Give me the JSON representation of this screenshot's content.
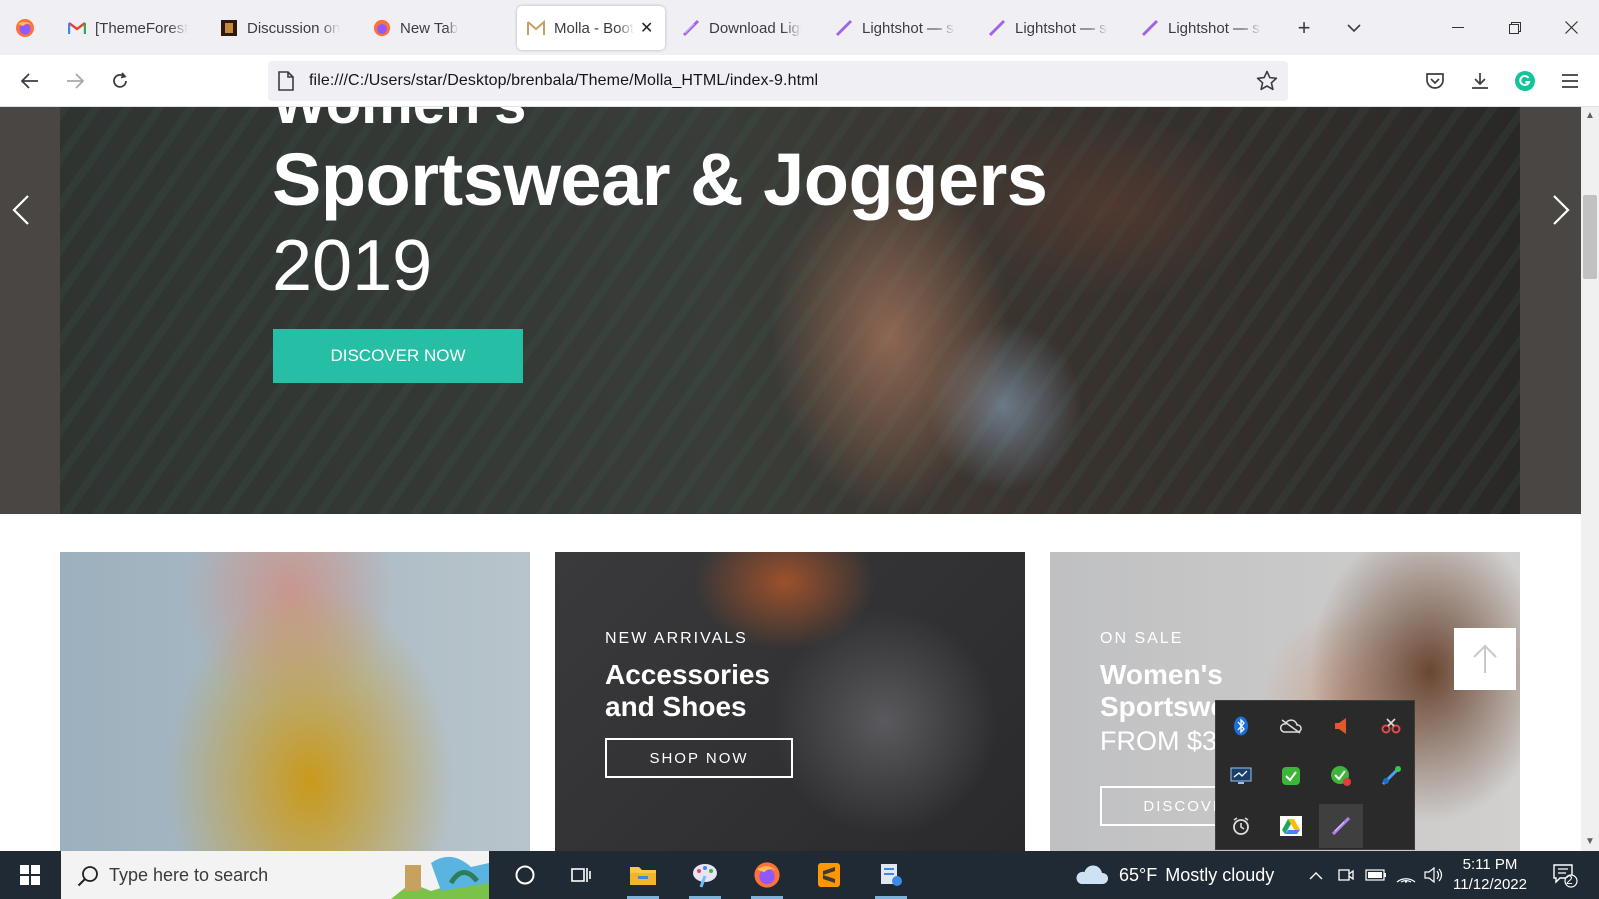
{
  "browser": {
    "tabs": [
      {
        "label": "[ThemeForest]",
        "icon": "gmail-icon"
      },
      {
        "label": "Discussion on I",
        "icon": "themeforest-icon"
      },
      {
        "label": "New Tab",
        "icon": "firefox-icon"
      },
      {
        "label": "Molla - Boot",
        "icon": "molla-icon",
        "active": true
      },
      {
        "label": "Download Ligh",
        "icon": "lightshot-icon"
      },
      {
        "label": "Lightshot — sc",
        "icon": "lightshot-icon"
      },
      {
        "label": "Lightshot — sc",
        "icon": "lightshot-icon"
      },
      {
        "label": "Lightshot — sc",
        "icon": "lightshot-icon"
      }
    ],
    "url": "file:///C:/Users/star/Desktop/brenbala/Theme/Molla_HTML/index-9.html"
  },
  "hero": {
    "pre_title": "Women's",
    "title": "Sportswear & Joggers",
    "year": "2019",
    "button": "DISCOVER NOW"
  },
  "banners": [
    {
      "subtitle": "",
      "title": "",
      "button": ""
    },
    {
      "subtitle": "NEW ARRIVALS",
      "title_line1": "Accessories",
      "title_line2": "and Shoes",
      "button": "SHOP NOW"
    },
    {
      "subtitle": "ON SALE",
      "title_line1": "Women's",
      "title_line2": "Sportswear",
      "price": "FROM $39",
      "button": "DISCOVER NOW"
    }
  ],
  "taskbar": {
    "search_placeholder": "Type here to search",
    "weather_temp": "65°F",
    "weather_desc": "Mostly cloudy",
    "time": "5:11 PM",
    "date": "11/12/2022",
    "notification_count": "2"
  },
  "colors": {
    "accent": "#26bea4",
    "taskbar": "#1f2a34"
  }
}
